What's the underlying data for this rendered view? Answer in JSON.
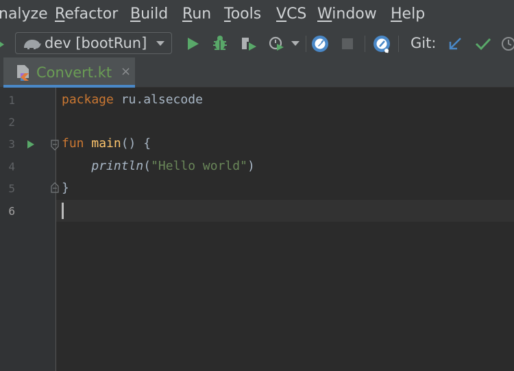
{
  "menu": {
    "items": [
      {
        "label": "nalyze",
        "mnemonic": ""
      },
      {
        "label": "efactor",
        "mnemonic": "R"
      },
      {
        "label": "uild",
        "mnemonic": "B"
      },
      {
        "label": "un",
        "mnemonic": "R"
      },
      {
        "label": "ools",
        "mnemonic": "T"
      },
      {
        "label": "CS",
        "mnemonic": "V"
      },
      {
        "label": "indow",
        "mnemonic": "W"
      },
      {
        "label": "elp",
        "mnemonic": "H"
      }
    ]
  },
  "toolbar": {
    "run_config": "dev [bootRun]",
    "git_label": "Git:"
  },
  "tab": {
    "title": "Convert.kt",
    "close_glyph": "×"
  },
  "editor": {
    "line_numbers": [
      "1",
      "2",
      "3",
      "4",
      "5",
      "6"
    ],
    "code": {
      "l1_kw": "package",
      "l1_rest": " ru.alsecode",
      "l3_kw": "fun",
      "l3_fn": "main",
      "l3_rest": "() {",
      "l4_call": "println",
      "l4_open": "(",
      "l4_str": "\"Hello world\"",
      "l4_close": ")",
      "l5": "}"
    }
  },
  "colors": {
    "keyword": "#cc7832",
    "function": "#ffc66d",
    "string": "#6a8759",
    "run_green": "#59a869",
    "accent_blue": "#4a88c7"
  }
}
